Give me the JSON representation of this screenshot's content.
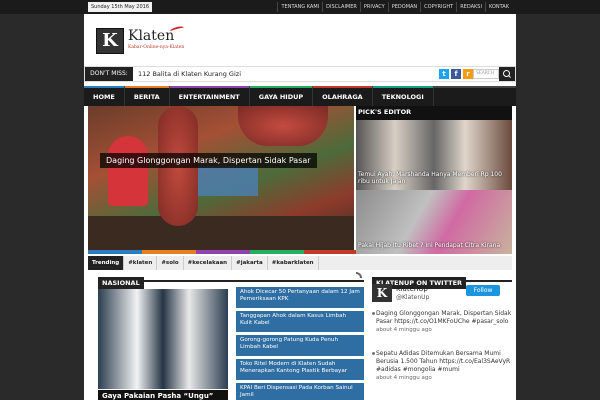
{
  "topbar": {
    "date": "Sunday 15th May 2016",
    "menu": [
      "TENTANG KAMI",
      "DISCLAIMER",
      "PRIVACY",
      "PEDOMAN",
      "COPYRIGHT",
      "REDAKSI",
      "KONTAK"
    ]
  },
  "header": {
    "logo_letter": "K",
    "site_name": "Klaten",
    "tagline": "Kabar-Online-nya-Klaten"
  },
  "dontmiss": {
    "label": "DON'T MISS:",
    "headline": "112 Balita di Klaten Kurang Gizi",
    "search_placeholder": "SEARCH"
  },
  "social": [
    "twitter-icon",
    "facebook-icon",
    "rss-icon"
  ],
  "nav": [
    "HOME",
    "BERITA",
    "ENTERTAINMENT",
    "GAYA HIDUP",
    "OLAHRAGA",
    "TEKNOLOGI"
  ],
  "slider": {
    "caption": "Daging Glonggongan Marak, Dispertan Sidak Pasar",
    "bar_colors": [
      "#2c7fbf",
      "#e67e22",
      "#8e44ad",
      "#27ae60",
      "#c0392b"
    ]
  },
  "picks": {
    "title": "PICK'S EDITOR",
    "items": [
      "Temui Ayah, Marshanda Hanya Memberi Rp 100 ribu untuk Jajan",
      "Pakai Hijab Itu Ribet ? Ini Pendapat Citra Kirana"
    ]
  },
  "trending": {
    "label": "Trending",
    "tags": [
      "#klaten",
      "#solo",
      "#kecelakaan",
      "#jakarta",
      "#kabarklaten"
    ]
  },
  "nasional": {
    "title": "NASIONAL",
    "feature_title": "Gaya Pakaian Pasha “Ungu” Membuat Mendagri Tertawa",
    "list": [
      "Ahok Dicecar 50 Pertanyaan dalam 12 Jam Pemeriksaan KPK",
      "Tanggapan Ahok dalam Kasus Limbah Kulit Kabel",
      "Gorong-gorong Patung Kuda Penuh Limbah Kabel",
      "Toko Ritel Modern di Klaten Sudah Menerapkan Kantong Plastik Berbayar",
      "KPAI Beri Dispensasi Pada Korban Sainul Jamil"
    ]
  },
  "twitter": {
    "title": "KLATENUP ON TWITTER",
    "name": "KlatenUp",
    "handle": "@KlatenUp",
    "follow": "Follow",
    "tweets": [
      {
        "text": "Daging Glonggongan Marak, Dispertan Sidak Pasar https://t.co/O1MKFoUChe #pasar_solo",
        "time": "about 4 minggu ago"
      },
      {
        "text": "Sepatu Adidas Ditemukan Bersama Mumi Berusia 1.500 Tahun https://t.co/Eal3SAeVyR #adidas #mongolia #mumi",
        "time": "about 4 minggu ago"
      }
    ]
  }
}
